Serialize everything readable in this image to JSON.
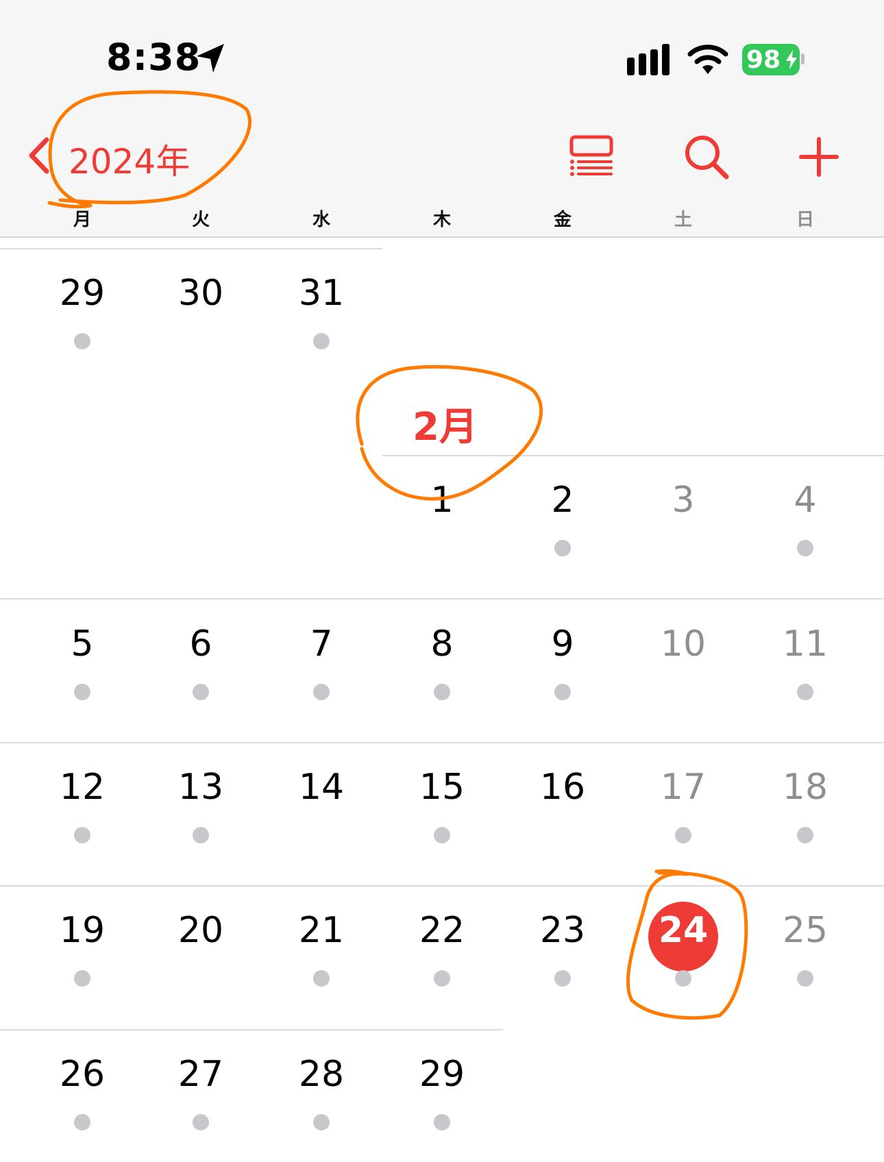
{
  "status_bar": {
    "time": "8:38",
    "battery": "98"
  },
  "nav": {
    "back_label": "2024年"
  },
  "weekdays": [
    "月",
    "火",
    "水",
    "木",
    "金",
    "土",
    "日"
  ],
  "month_label": "2月",
  "prev_month": {
    "days": [
      "29",
      "30",
      "31"
    ]
  },
  "rows": [
    [
      "",
      "",
      "",
      "1",
      "2",
      "3",
      "4"
    ],
    [
      "5",
      "6",
      "7",
      "8",
      "9",
      "10",
      "11"
    ],
    [
      "12",
      "13",
      "14",
      "15",
      "16",
      "17",
      "18"
    ],
    [
      "19",
      "20",
      "21",
      "22",
      "23",
      "24",
      "25"
    ],
    [
      "26",
      "27",
      "28",
      "29",
      "",
      "",
      ""
    ]
  ],
  "today": "24",
  "colors": {
    "accent": "#ef3b36",
    "annotation": "#ff7a00",
    "dot": "#c7c7cc",
    "weekend_text": "#8e8e93"
  },
  "icons": [
    "location-arrow-icon",
    "cellular-signal-icon",
    "wifi-icon",
    "battery-icon",
    "chevron-left-icon",
    "list-view-icon",
    "search-icon",
    "plus-icon"
  ]
}
